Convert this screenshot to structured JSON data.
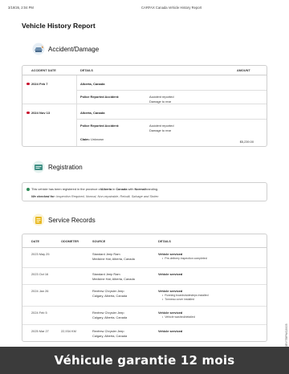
{
  "print_header": {
    "date": "3/19/26, 2:04 PM",
    "title": "CARFAX Canada Vehicle History Report"
  },
  "document": {
    "title": "Vehicle History Report"
  },
  "accident_damage": {
    "title": "Accident/Damage",
    "icon": "accident-icon",
    "columns": {
      "date": "ACCIDENT DATE",
      "details": "DETAILS",
      "amount": "AMOUNT"
    },
    "records": [
      {
        "date": "2024 Feb 7",
        "location": "Alberta, Canada",
        "details_label": "Police Reported Accident:",
        "details_values": [
          "Accident reported",
          "Damage to rear"
        ],
        "claim_label": "",
        "claim_value": "",
        "amount": ""
      },
      {
        "date": "2024 Nov 13",
        "location": "Alberta, Canada",
        "details_label": "Police Reported Accident:",
        "details_values": [
          "Accident reported",
          "Damage to rear"
        ],
        "claim_label": "Claim:",
        "claim_value": "Unknown",
        "amount": "$5,239.00"
      }
    ]
  },
  "registration": {
    "title": "Registration",
    "icon": "registration-icon",
    "line1_prefix": "This vehicle has been registered in the province of ",
    "province": "Alberta",
    "line1_mid": " in ",
    "country": "Canada",
    "line1_mid2": " with ",
    "branding": "Normal",
    "line1_suffix": " branding.",
    "line2_label": "We checked for:",
    "line2_text": " Inspection Required, Normal, Non-repairable, Rebuilt, Salvage and Stolen"
  },
  "service_records": {
    "title": "Service Records",
    "icon": "service-records-icon",
    "columns": {
      "date": "DATE",
      "odometer": "ODOMETER",
      "source": "SOURCE",
      "details": "DETAILS"
    },
    "rows": [
      {
        "date": "2023 May 25",
        "odometer": "",
        "source1": "Standard Jeep Ram",
        "source2": "Medicine Hat, Alberta, Canada",
        "details": "Vehicle serviced",
        "bullets": [
          "Pre-delivery inspection completed"
        ]
      },
      {
        "date": "2023 Oct 16",
        "odometer": "",
        "source1": "Standard Jeep Ram",
        "source2": "Medicine Hat, Alberta, Canada",
        "details": "Vehicle serviced",
        "bullets": []
      },
      {
        "date": "2024 Jan 26",
        "odometer": "",
        "source1": "Renfrew Chrysler Jeep",
        "source2": "Calgary, Alberta, Canada",
        "details": "Vehicle serviced",
        "bullets": [
          "Running boards/sidesteps installed",
          "Tonneau cover installed"
        ]
      },
      {
        "date": "2024 Feb 5",
        "odometer": "",
        "source1": "Renfrew Chrysler Jeep",
        "source2": "Calgary, Alberta, Canada",
        "details": "Vehicle serviced",
        "bullets": [
          "Vehicle washed/detailed"
        ]
      },
      {
        "date": "2025 Mar 27",
        "odometer": "22,934 KM",
        "source1": "Renfrew Chrysler Jeep",
        "source2": "Calgary, Alberta, Canada",
        "details": "Vehicle serviced",
        "bullets": []
      }
    ]
  },
  "side_text": "3RYTBFNG2005",
  "banner": {
    "text": "Véhicule garantie 12 mois"
  },
  "colors": {
    "accident_dot": "#c8102e",
    "check": "#2e8b57",
    "banner_bg": "#3b3b3b"
  }
}
